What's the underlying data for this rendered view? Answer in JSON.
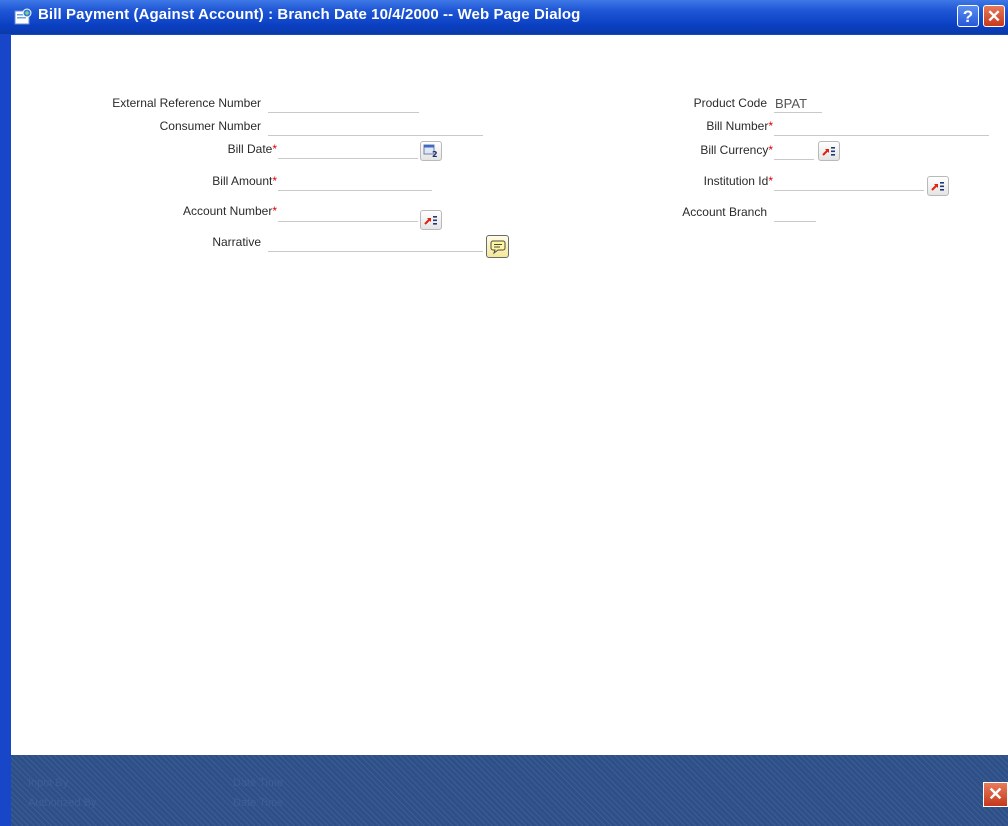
{
  "window": {
    "title": "Bill Payment (Against Account) : Branch Date 10/4/2000 -- Web Page Dialog",
    "help_glyph": "?",
    "close_glyph": "✕"
  },
  "form": {
    "left": {
      "external_reference_number": {
        "label": "External Reference Number",
        "value": ""
      },
      "consumer_number": {
        "label": "Consumer Number",
        "value": ""
      },
      "bill_date": {
        "label": "Bill Date",
        "required": "*",
        "value": ""
      },
      "bill_amount": {
        "label": "Bill Amount",
        "required": "*",
        "value": ""
      },
      "account_number": {
        "label": "Account Number",
        "required": "*",
        "value": ""
      },
      "narrative": {
        "label": "Narrative",
        "value": ""
      }
    },
    "right": {
      "product_code": {
        "label": "Product Code",
        "value": "BPAT"
      },
      "bill_number": {
        "label": "Bill Number",
        "required": "*",
        "value": ""
      },
      "bill_currency": {
        "label": "Bill Currency",
        "required": "*",
        "value": ""
      },
      "institution_id": {
        "label": "Institution Id",
        "required": "*",
        "value": ""
      },
      "account_branch": {
        "label": "Account Branch",
        "value": ""
      }
    }
  },
  "footer": {
    "input_by": "Input By",
    "date_time_1": "Date Time",
    "authorized_by": "Authorized By",
    "date_time_2": "Date Time",
    "exit_glyph": "✕"
  },
  "icons": {
    "calendar": "calendar-icon",
    "lov": "list-of-values-icon",
    "narrative_editor": "speech-bubble-icon"
  },
  "colors": {
    "title_bar": "#1f57d6",
    "frame": "#1746c8",
    "footer": "#2e5089",
    "required_marker": "#d00000"
  }
}
